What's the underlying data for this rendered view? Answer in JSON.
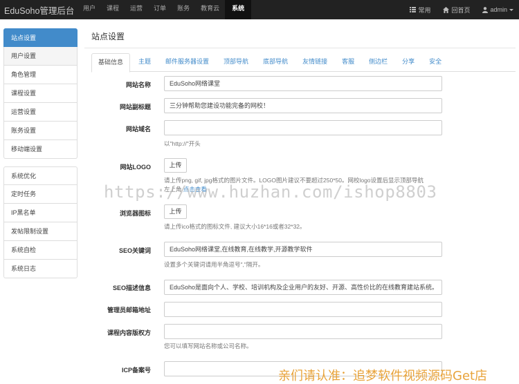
{
  "topbar": {
    "brand": "EduSoho管理后台",
    "nav": [
      "用户",
      "课程",
      "运营",
      "订单",
      "账务",
      "教育云",
      "系统"
    ],
    "active_nav": "系统",
    "right": {
      "common": "常用",
      "home": "回首页",
      "user": "admin"
    }
  },
  "sidebar": {
    "group1": [
      "站点设置",
      "用户设置",
      "角色管理",
      "课程设置",
      "运营设置",
      "账务设置",
      "移动端设置"
    ],
    "group2": [
      "系统优化",
      "定时任务",
      "IP黑名单",
      "发帖限制设置",
      "系统自检",
      "系统日志"
    ],
    "active": "站点设置"
  },
  "main": {
    "title": "站点设置",
    "tabs": [
      "基础信息",
      "主题",
      "邮件服务器设置",
      "顶部导航",
      "底部导航",
      "友情链接",
      "客服",
      "侧边栏",
      "分享",
      "安全"
    ],
    "active_tab": "基础信息"
  },
  "form": {
    "site_name": {
      "label": "网站名称",
      "value": "EduSoho网络课堂"
    },
    "site_subtitle": {
      "label": "网站副标题",
      "value": "三分钟帮助您建设功能完备的网校！"
    },
    "site_domain": {
      "label": "网站域名",
      "value": "",
      "help": "以\"http://\"开头"
    },
    "site_logo": {
      "label": "网站LOGO",
      "button": "上传",
      "help1": "请上传png, gif, jpg格式的图片文件。LOGO图片建议不要超过250*50。网校logo设置后显示顶部导航",
      "help2_prefix": "左上角",
      "help2_link": "点击查看"
    },
    "favicon": {
      "label": "浏览器图标",
      "button": "上传",
      "help": "请上传ico格式的图标文件, 建议大小16*16或者32*32。"
    },
    "seo_keywords": {
      "label": "SEO关键词",
      "value": "EduSoho网络课堂,在线教育,在线教学,开源教学软件",
      "help": "设置多个关键词请用半角逗号\",\"隔开。"
    },
    "seo_description": {
      "label": "SEO描述信息",
      "value": "EduSoho是面向个人、学校、培训机构及企业用户的友好、开源、高性价比的在线教育建站系统。"
    },
    "admin_email": {
      "label": "管理员邮箱地址",
      "value": ""
    },
    "copyright": {
      "label": "课程内容版权方",
      "value": "",
      "help": "您可以填写网站名称或公司名称。"
    },
    "icp": {
      "label": "ICP备案号",
      "value": ""
    }
  },
  "overlays": {
    "watermark": "https://www.huzhan.com/ishop8803",
    "bottom_brand": "亲们请认准：追梦软件视频源码Get店"
  }
}
